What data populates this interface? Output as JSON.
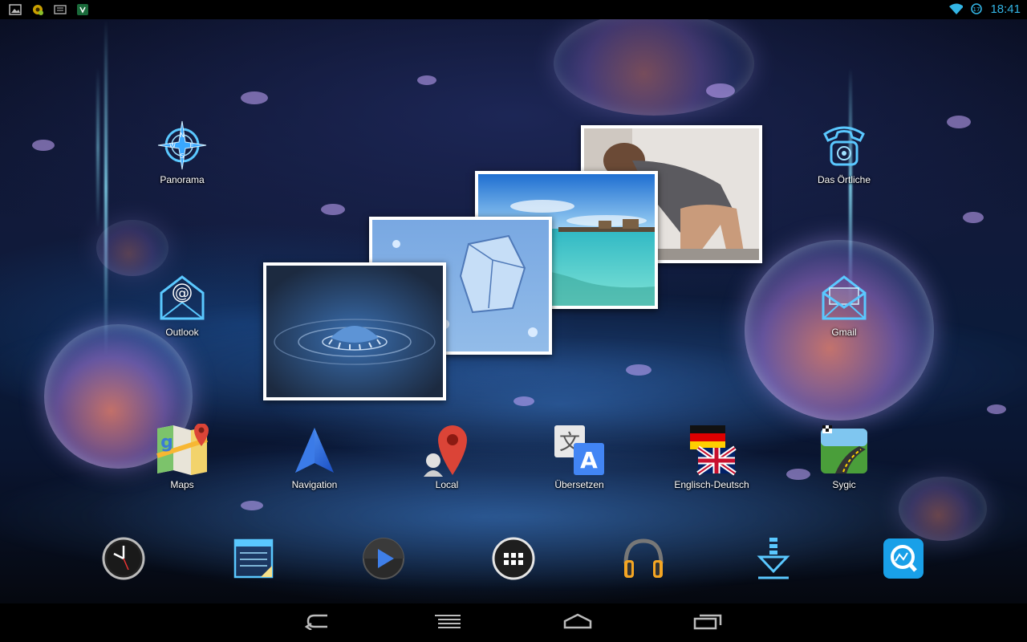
{
  "status_bar": {
    "time": "18:41",
    "notification_icons": [
      "gallery-icon",
      "settings-gear-icon",
      "keyboard-icon",
      "shield-icon"
    ],
    "status_icons": [
      "wifi-icon",
      "sync-icon"
    ]
  },
  "apps": [
    {
      "id": "panorama",
      "label": "Panorama",
      "icon": "compass-icon"
    },
    {
      "id": "das-oertliche",
      "label": "Das Örtliche",
      "icon": "phone-icon"
    },
    {
      "id": "outlook",
      "label": "Outlook",
      "icon": "email-at-icon"
    },
    {
      "id": "gmail",
      "label": "Gmail",
      "icon": "envelope-icon"
    },
    {
      "id": "maps",
      "label": "Maps",
      "icon": "maps-icon"
    },
    {
      "id": "navigation",
      "label": "Navigation",
      "icon": "navigation-arrow-icon"
    },
    {
      "id": "local",
      "label": "Local",
      "icon": "map-pin-icon"
    },
    {
      "id": "uebersetzen",
      "label": "Übersetzen",
      "icon": "translate-icon"
    },
    {
      "id": "englisch-deutsch",
      "label": "Englisch-Deutsch",
      "icon": "flags-icon"
    },
    {
      "id": "sygic",
      "label": "Sygic",
      "icon": "road-icon"
    }
  ],
  "dock": [
    {
      "id": "clock",
      "icon": "clock-icon"
    },
    {
      "id": "notes",
      "icon": "notepad-icon"
    },
    {
      "id": "video",
      "icon": "play-icon"
    },
    {
      "id": "all-apps",
      "icon": "app-drawer-icon"
    },
    {
      "id": "music",
      "icon": "headphones-icon"
    },
    {
      "id": "downloads",
      "icon": "download-icon"
    },
    {
      "id": "qq",
      "icon": "search-q-icon"
    }
  ],
  "nav": [
    "back-icon",
    "menu-icon",
    "home-icon",
    "recents-icon"
  ],
  "colors": {
    "accent": "#33b5e5",
    "icon_glow": "#4fc3ff"
  }
}
